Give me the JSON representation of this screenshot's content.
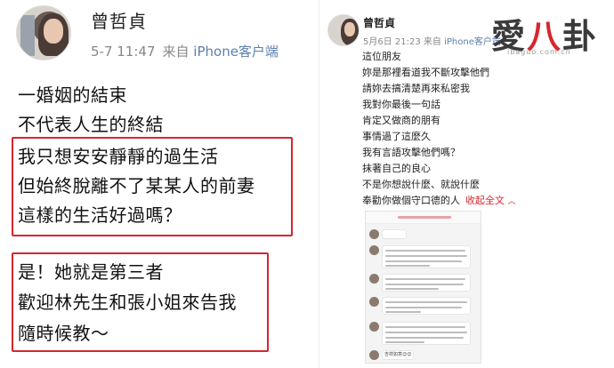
{
  "left_post": {
    "username": "曾哲貞",
    "timestamp": "5-7 11:47",
    "source_prefix": "来自",
    "source": "iPhone客户端",
    "lines": [
      "一婚姻的結束",
      "不代表人生的終結",
      "我只想安安靜靜的過生活",
      "但始終脫離不了某某人的前妻",
      "這樣的生活好過嗎？",
      "是！她就是第三者",
      "歡迎林先生和張小姐來告我",
      "隨時候教～"
    ]
  },
  "right_post": {
    "username": "曾哲貞",
    "timestamp": "5月6日 21:23",
    "source_prefix": "来自",
    "source": "iPhone客户端",
    "lines": [
      "這位朋友",
      "妳是那裡看道我不斷攻擊他們",
      "請妳去搞清楚再來私密我",
      "我對你最後一句話",
      "肯定又做商的朋有",
      "事情過了這麼久",
      "我有言語攻擊他們嗎？",
      "抹著自己的良心",
      "不是你想說什麼、就說什麼",
      "奉勸你做個守口德的人"
    ],
    "expand_label": "收起全文"
  },
  "chat_screenshot": {
    "last_message": "吉祥如意😊😊"
  },
  "logo": {
    "text_main": "愛",
    "text_accent": "八",
    "text_end": "卦",
    "url": "ibaguo.com.cn"
  },
  "colors": {
    "highlight_box": "#d7262e",
    "link_blue": "#5d7fae",
    "meta_gray": "#888888"
  }
}
